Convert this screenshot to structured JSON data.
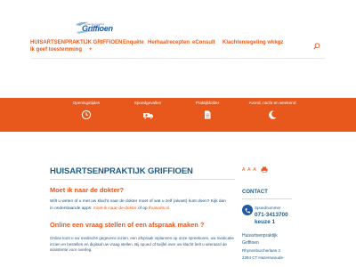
{
  "header": {
    "logo": {
      "tagline": "huisartsenpraktijk",
      "wordmark": "Griffioen"
    },
    "nav": [
      {
        "label": "HUISARTSENPRAKTIJK GRIFFIOEN"
      },
      {
        "label": "Enquête"
      },
      {
        "label": "Herhaalrecepten"
      },
      {
        "label": "eConsult"
      },
      {
        "label": "Klachtenregeling wkkgz"
      },
      {
        "label": "Ik geef toestemming"
      }
    ],
    "nav_plus": "+",
    "search_icon": "search-icon"
  },
  "band": {
    "color": "#e8571c",
    "items": [
      {
        "label": "Openingstijden",
        "icon": "clock-icon"
      },
      {
        "label": "Spoedgevallen",
        "icon": "ambulance-icon"
      },
      {
        "label": "Praktijkfolder",
        "icon": "document-icon"
      },
      {
        "label": "Avond, nacht en weekend",
        "icon": "moon-icon"
      }
    ]
  },
  "main": {
    "title": "HUISARTSENPRAKTIJK GRIFFIOEN",
    "question1": "Moet ik naar de dokter?",
    "body1_part1": "Wilt u weten of u met uw klacht naar de dokter moet of wat u zelf (alvast) kunt doen? Kijk dan in onderstaande apps: ",
    "body1_link1": "moet-ik-naar-de-dokter",
    "body1_part2": " of op ",
    "body1_link2": "thuisarts.nl",
    "question2": "Online een vraag stellen of een afspraak maken ?",
    "body2": "Online kunt u uw medische gegevens inzien, een afspraak inplannen op onze spreekuren, uw medicatie inzien en bestellen en digitaal uw vraag stellen. Bij spoed of twijfel over uw klacht belt u uiteraard de assistente voor overleg."
  },
  "sidebar": {
    "font_controls": "A A A",
    "print_icon": "print-icon",
    "contact_title": "CONTACT",
    "spoed_label": "Spoednummer",
    "spoed_number": "071-3413700",
    "spoed_sub": "keuze 1",
    "practice_name_1": "Huisartsenpraktijk",
    "practice_name_2": "Griffioen",
    "street": "Rhynenburcherlaan 2",
    "city": "2394 CT Hazerswoude-"
  },
  "colors": {
    "accent": "#e8571c",
    "brand_blue": "#1d5b86"
  }
}
